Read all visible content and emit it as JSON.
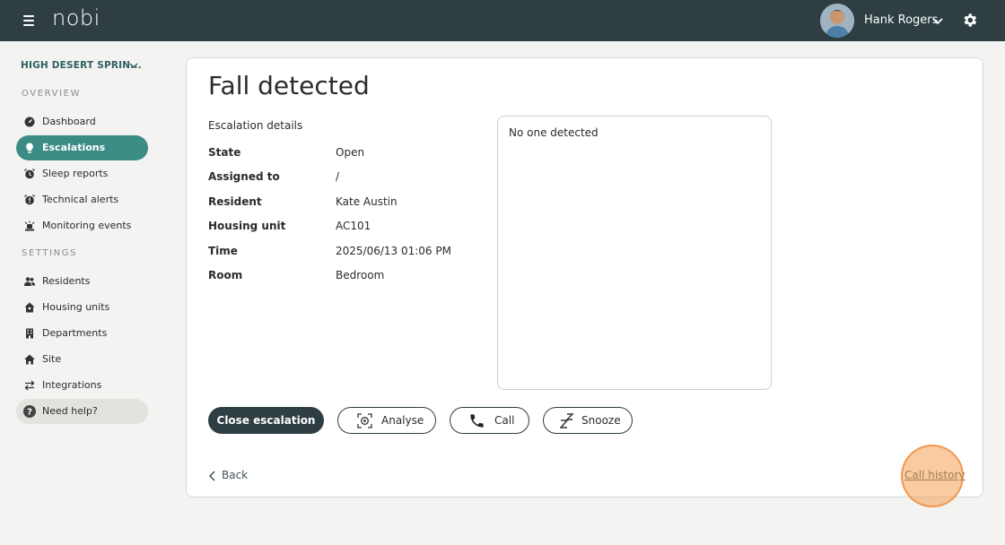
{
  "header": {
    "logo": "nobi",
    "user_name": "Hank Rogers"
  },
  "sidebar": {
    "site_name": "HIGH DESERT SPRIN...",
    "overview_label": "OVERVIEW",
    "settings_label": "SETTINGS",
    "overview_items": [
      {
        "label": "Dashboard",
        "icon": "gauge-icon"
      },
      {
        "label": "Escalations",
        "icon": "lightbulb-icon",
        "active": true
      },
      {
        "label": "Sleep reports",
        "icon": "alarm-clock-icon"
      },
      {
        "label": "Technical alerts",
        "icon": "siren-icon"
      },
      {
        "label": "Monitoring events",
        "icon": "monitoring-icon"
      }
    ],
    "settings_items": [
      {
        "label": "Residents",
        "icon": "people-icon"
      },
      {
        "label": "Housing units",
        "icon": "house-icon"
      },
      {
        "label": "Departments",
        "icon": "building-icon"
      },
      {
        "label": "Site",
        "icon": "home-icon"
      },
      {
        "label": "Integrations",
        "icon": "arrows-icon"
      }
    ],
    "help_label": "Need help?"
  },
  "main": {
    "title": "Fall detected",
    "details_heading": "Escalation details",
    "details": [
      {
        "label": "State",
        "value": "Open"
      },
      {
        "label": "Assigned to",
        "value": "/"
      },
      {
        "label": "Resident",
        "value": "Kate Austin"
      },
      {
        "label": "Housing unit",
        "value": "AC101"
      },
      {
        "label": "Time",
        "value": "2025/06/13 01:06 PM"
      },
      {
        "label": "Room",
        "value": "Bedroom"
      }
    ],
    "detection_text": "No one detected",
    "buttons": {
      "close": "Close escalation",
      "analyse": "Analyse",
      "call": "Call",
      "snooze": "Snooze"
    },
    "back_label": "Back",
    "call_history_label": "Call history"
  },
  "colors": {
    "topbar": "#2e3e42",
    "accent": "#3c8c86",
    "background": "#f3f3f1",
    "highlight": "#f59e52"
  }
}
